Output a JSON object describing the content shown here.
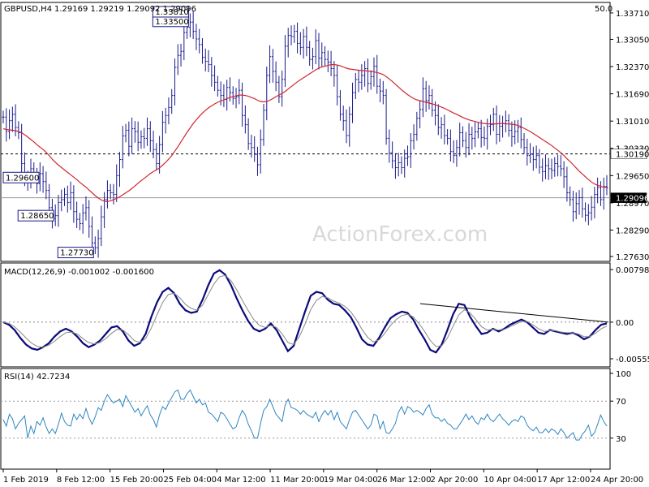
{
  "chart_data": {
    "type": "line",
    "instrument": "GBPUSD,H4",
    "ohlc_header": "1.29169 1.29219 1.29092 1.29096",
    "corner_label": "50.0",
    "watermark": "ActionForex.com",
    "x_tick_labels": [
      "1 Feb 2019",
      "8 Feb 12:00",
      "15 Feb 20:00",
      "25 Feb 04:00",
      "4 Mar 12:00",
      "11 Mar 20:00",
      "19 Mar 04:00",
      "26 Mar 12:00",
      "2 Apr 20:00",
      "10 Apr 04:00",
      "17 Apr 12:00",
      "24 Apr 20:00"
    ],
    "price": {
      "ylim": [
        1.2759,
        1.3387
      ],
      "y_tick_labels": [
        "1.33710",
        "1.33050",
        "1.32370",
        "1.31690",
        "1.31010",
        "1.30330",
        "1.29650",
        "1.28970",
        "1.28290",
        "1.27630"
      ],
      "y_tick_values": [
        1.3371,
        1.3305,
        1.3237,
        1.3169,
        1.3101,
        1.3033,
        1.2965,
        1.2897,
        1.2829,
        1.2763
      ],
      "current_price": 1.29096,
      "current_price_label": "1.29096",
      "reference_level": 1.3019,
      "reference_level_label": "1.30190",
      "annotations": [
        {
          "label": "1.33500",
          "value": 1.335
        },
        {
          "label": "1.33810",
          "value": 1.3381
        },
        {
          "label": "1.29600",
          "value": 1.296
        },
        {
          "label": "1.27730",
          "value": 1.2773
        },
        {
          "label": "1.28650",
          "value": 1.2865
        }
      ],
      "series": [
        {
          "values": [
            1.3111,
            1.3075,
            1.3102,
            1.3118,
            1.3085,
            1.3072,
            1.2995,
            1.2958,
            1.2955,
            1.2982,
            1.2962,
            1.2945,
            1.297,
            1.295,
            1.2928,
            1.2885,
            1.2858,
            1.2865,
            1.2898,
            1.2905,
            1.2918,
            1.2898,
            1.2922,
            1.2875,
            1.2856,
            1.2845,
            1.2872,
            1.2885,
            1.2838,
            1.2797,
            1.2785,
            1.2808,
            1.2862,
            1.2905,
            1.2928,
            1.2922,
            1.2918,
            1.2965,
            1.3005,
            1.3064,
            1.3078,
            1.3038,
            1.3082,
            1.3075,
            1.3048,
            1.3062,
            1.3058,
            1.3082,
            1.3052,
            1.303,
            1.2995,
            1.3042,
            1.3098,
            1.3115,
            1.3135,
            1.3165,
            1.3235,
            1.3265,
            1.3275,
            1.3322,
            1.3335,
            1.3348,
            1.3325,
            1.3306,
            1.3292,
            1.326,
            1.325,
            1.3242,
            1.3215,
            1.3198,
            1.3178,
            1.3165,
            1.3155,
            1.3185,
            1.3172,
            1.3158,
            1.3162,
            1.3178,
            1.3115,
            1.3092,
            1.3045,
            1.3035,
            1.3018,
            1.2992,
            1.3055,
            1.3128,
            1.3215,
            1.3262,
            1.3225,
            1.3198,
            1.3162,
            1.3205,
            1.3288,
            1.3315,
            1.3312,
            1.3325,
            1.3295,
            1.3285,
            1.3312,
            1.3285,
            1.3255,
            1.3262,
            1.3302,
            1.3258,
            1.3272,
            1.3255,
            1.3248,
            1.3232,
            1.3215,
            1.3162,
            1.3118,
            1.3102,
            1.3065,
            1.3118,
            1.3172,
            1.3205,
            1.3198,
            1.3215,
            1.3232,
            1.3195,
            1.3212,
            1.3238,
            1.3188,
            1.3176,
            1.3165,
            1.3058,
            1.3022,
            1.3002,
            1.2985,
            1.2997,
            1.2985,
            1.3008,
            1.3012,
            1.3052,
            1.3068,
            1.3108,
            1.313,
            1.3182,
            1.3152,
            1.3165,
            1.3128,
            1.3115,
            1.3085,
            1.3092,
            1.3065,
            1.3058,
            1.3025,
            1.3015,
            1.3035,
            1.3072,
            1.3052,
            1.3035,
            1.3068,
            1.3058,
            1.3074,
            1.3082,
            1.306,
            1.3058,
            1.3088,
            1.3092,
            1.3118,
            1.3068,
            1.3088,
            1.3095,
            1.3102,
            1.3078,
            1.3062,
            1.3075,
            1.3085,
            1.3055,
            1.3035,
            1.3015,
            1.3018,
            1.3005,
            1.3015,
            1.2986,
            1.2975,
            1.299,
            1.2982,
            1.2978,
            1.2995,
            1.2988,
            1.2982,
            1.2962,
            1.2922,
            1.2905,
            1.2875,
            1.2895,
            1.291,
            1.2882,
            1.2866,
            1.2872,
            1.2886,
            1.2918,
            1.2935,
            1.2905,
            1.2938,
            1.2935
          ]
        },
        {
          "values": [
            1.3082,
            1.308,
            1.3079,
            1.3078,
            1.3077,
            1.3075,
            1.3072,
            1.3067,
            1.3061,
            1.3055,
            1.3049,
            1.3042,
            1.3036,
            1.303,
            1.3023,
            1.3015,
            1.3006,
            1.2998,
            1.2991,
            1.2985,
            1.2979,
            1.2973,
            1.2967,
            1.2961,
            1.2955,
            1.2948,
            1.2942,
            1.2936,
            1.2929,
            1.2922,
            1.2915,
            1.2909,
            1.2904,
            1.2901,
            1.29,
            1.2902,
            1.2905,
            1.2908,
            1.2912,
            1.2917,
            1.2922,
            1.2927,
            1.2933,
            1.2939,
            1.2946,
            1.2952,
            1.2958,
            1.2964,
            1.297,
            1.2975,
            1.2979,
            1.2984,
            1.2991,
            1.2998,
            1.3006,
            1.3015,
            1.3026,
            1.3037,
            1.3049,
            1.3061,
            1.3073,
            1.3084,
            1.3095,
            1.3104,
            1.3113,
            1.3121,
            1.3128,
            1.3134,
            1.3139,
            1.3144,
            1.3148,
            1.3151,
            1.3154,
            1.3157,
            1.316,
            1.3162,
            1.3164,
            1.3166,
            1.3166,
            1.3165,
            1.3163,
            1.316,
            1.3157,
            1.3153,
            1.315,
            1.3149,
            1.315,
            1.3153,
            1.3157,
            1.3162,
            1.3166,
            1.317,
            1.3175,
            1.3181,
            1.3187,
            1.3193,
            1.3199,
            1.3204,
            1.3209,
            1.3214,
            1.3219,
            1.3224,
            1.3229,
            1.3233,
            1.3236,
            1.3238,
            1.324,
            1.3242,
            1.3242,
            1.3241,
            1.3239,
            1.3236,
            1.3233,
            1.3231,
            1.323,
            1.3229,
            1.3228,
            1.3227,
            1.3227,
            1.3226,
            1.3225,
            1.3224,
            1.3222,
            1.322,
            1.3217,
            1.3212,
            1.3206,
            1.32,
            1.3193,
            1.3186,
            1.3179,
            1.3173,
            1.3167,
            1.3162,
            1.3157,
            1.3154,
            1.3152,
            1.315,
            1.3148,
            1.3146,
            1.3144,
            1.3142,
            1.3139,
            1.3136,
            1.3133,
            1.3129,
            1.3125,
            1.3121,
            1.3118,
            1.3114,
            1.311,
            1.3107,
            1.3104,
            1.3102,
            1.31,
            1.3098,
            1.3096,
            1.3095,
            1.3094,
            1.3094,
            1.3094,
            1.3094,
            1.3095,
            1.3095,
            1.3094,
            1.3094,
            1.3093,
            1.3092,
            1.309,
            1.3087,
            1.3083,
            1.3079,
            1.3075,
            1.307,
            1.3065,
            1.306,
            1.3055,
            1.305,
            1.3045,
            1.304,
            1.3034,
            1.3028,
            1.3022,
            1.3015,
            1.3007,
            1.3,
            1.2992,
            1.2984,
            1.2976,
            1.2969,
            1.2962,
            1.2955,
            1.2949,
            1.2944,
            1.2941,
            1.2938,
            1.2936,
            1.2935
          ]
        }
      ],
      "colors": {
        "bars": "#1a1a8c",
        "ma": "#d0262e"
      }
    },
    "macd": {
      "label": "MACD(12,26,9) -0.001002 -0.001600",
      "ylim": [
        -0.0063,
        0.008
      ],
      "y_tick_labels": [
        "0.007983",
        "0.00",
        "-0.005559"
      ],
      "y_tick_values": [
        0.007983,
        0.0,
        -0.005559
      ],
      "series": [
        {
          "values": [
            0.0,
            -0.0004,
            -0.0012,
            -0.0024,
            -0.0034,
            -0.004,
            -0.0042,
            -0.0038,
            -0.0032,
            -0.0022,
            -0.0014,
            -0.001,
            -0.0014,
            -0.0022,
            -0.0032,
            -0.0038,
            -0.0034,
            -0.0028,
            -0.0018,
            -0.0008,
            -0.0006,
            -0.0014,
            -0.0028,
            -0.0036,
            -0.0032,
            -0.0018,
            0.0008,
            0.003,
            0.0046,
            0.0052,
            0.0044,
            0.0028,
            0.0018,
            0.0014,
            0.0016,
            0.0034,
            0.0056,
            0.0074,
            0.0079,
            0.0072,
            0.0056,
            0.0036,
            0.0018,
            0.0002,
            -0.001,
            -0.0014,
            -0.001,
            -0.0002,
            -0.0012,
            -0.0028,
            -0.0044,
            -0.0036,
            -0.001,
            0.0016,
            0.004,
            0.0046,
            0.0044,
            0.0034,
            0.0028,
            0.0026,
            0.0018,
            0.0008,
            -0.0008,
            -0.0026,
            -0.0034,
            -0.0036,
            -0.0024,
            -0.0008,
            0.0006,
            0.0012,
            0.0016,
            0.0014,
            0.0004,
            -0.0012,
            -0.0026,
            -0.0042,
            -0.0046,
            -0.0034,
            -0.0012,
            0.0012,
            0.0028,
            0.0026,
            0.0008,
            -0.0006,
            -0.0018,
            -0.0016,
            -0.001,
            -0.0014,
            -0.001,
            -0.0004,
            0.0,
            0.0004,
            0.0,
            -0.0008,
            -0.0016,
            -0.0018,
            -0.0012,
            -0.0014,
            -0.0016,
            -0.0018,
            -0.0016,
            -0.002,
            -0.0026,
            -0.0022,
            -0.0012,
            -0.0004,
            -0.0002
          ]
        },
        {
          "values": [
            0.0,
            -0.0002,
            -0.0007,
            -0.0015,
            -0.0024,
            -0.0032,
            -0.0037,
            -0.0038,
            -0.0035,
            -0.0029,
            -0.0022,
            -0.0016,
            -0.0015,
            -0.0018,
            -0.0025,
            -0.0031,
            -0.0033,
            -0.0031,
            -0.0025,
            -0.0017,
            -0.0011,
            -0.0012,
            -0.0019,
            -0.0028,
            -0.0031,
            -0.0025,
            -0.0009,
            0.0011,
            0.003,
            0.0042,
            0.0044,
            0.0037,
            0.0027,
            0.0021,
            0.0018,
            0.0026,
            0.0042,
            0.0058,
            0.0069,
            0.0071,
            0.0063,
            0.0049,
            0.0033,
            0.0018,
            0.0004,
            -0.0005,
            -0.0008,
            -0.0005,
            -0.0008,
            -0.0018,
            -0.0031,
            -0.0034,
            -0.0022,
            -0.0003,
            0.0019,
            0.0033,
            0.0039,
            0.0037,
            0.0032,
            0.0029,
            0.0024,
            0.0016,
            0.0004,
            -0.0011,
            -0.0023,
            -0.003,
            -0.0027,
            -0.0017,
            -0.0005,
            0.0004,
            0.001,
            0.0012,
            0.0008,
            -0.0002,
            -0.0014,
            -0.0028,
            -0.0037,
            -0.0036,
            -0.0024,
            -0.0006,
            0.0011,
            0.0019,
            0.0014,
            0.0004,
            -0.0007,
            -0.0012,
            -0.0011,
            -0.0012,
            -0.0011,
            -0.0007,
            -0.0003,
            0.0001,
            0.0001,
            -0.0004,
            -0.001,
            -0.0014,
            -0.0013,
            -0.0013,
            -0.0015,
            -0.0016,
            -0.0016,
            -0.0018,
            -0.0022,
            -0.0022,
            -0.0017,
            -0.001,
            -0.0006
          ]
        }
      ],
      "trendline": {
        "start": 0.0028,
        "end": 0.0
      }
    },
    "rsi": {
      "label": "RSI(14) 42.7234",
      "ylim": [
        0,
        100
      ],
      "y_tick_labels": [
        "100",
        "70",
        "30"
      ],
      "y_tick_values": [
        100,
        70,
        30
      ],
      "series": [
        {
          "values": [
            50,
            43,
            56,
            51,
            40,
            46,
            50,
            54,
            30,
            43,
            35,
            48,
            44,
            52,
            42,
            35,
            40,
            35,
            45,
            57,
            48,
            44,
            43,
            56,
            50,
            56,
            51,
            62,
            52,
            45,
            53,
            63,
            60,
            70,
            77,
            72,
            68,
            70,
            72,
            64,
            76,
            70,
            64,
            58,
            62,
            54,
            60,
            65,
            55,
            50,
            42,
            55,
            64,
            61,
            68,
            74,
            80,
            82,
            72,
            72,
            78,
            82,
            75,
            68,
            72,
            66,
            68,
            58,
            56,
            52,
            48,
            58,
            56,
            51,
            45,
            40,
            42,
            52,
            60,
            55,
            45,
            38,
            30,
            30,
            46,
            60,
            64,
            72,
            64,
            56,
            52,
            48,
            66,
            72,
            63,
            62,
            60,
            56,
            60,
            56,
            54,
            52,
            58,
            48,
            55,
            60,
            55,
            60,
            50,
            58,
            48,
            44,
            40,
            50,
            58,
            60,
            55,
            50,
            45,
            40,
            44,
            56,
            54,
            40,
            48,
            36,
            35,
            40,
            46,
            58,
            64,
            56,
            64,
            62,
            58,
            60,
            58,
            55,
            62,
            66,
            56,
            52,
            52,
            48,
            51,
            46,
            44,
            40,
            40,
            45,
            50,
            56,
            50,
            54,
            48,
            45,
            52,
            50,
            56,
            50,
            48,
            52,
            56,
            51,
            48,
            44,
            48,
            50,
            48,
            54,
            52,
            44,
            40,
            38,
            42,
            36,
            36,
            40,
            36,
            40,
            38,
            34,
            40,
            36,
            30,
            33,
            36,
            28,
            28,
            34,
            38,
            44,
            32,
            36,
            45,
            55,
            48,
            43
          ]
        }
      ],
      "colors": {
        "rsi": "#2e86c1"
      }
    }
  }
}
